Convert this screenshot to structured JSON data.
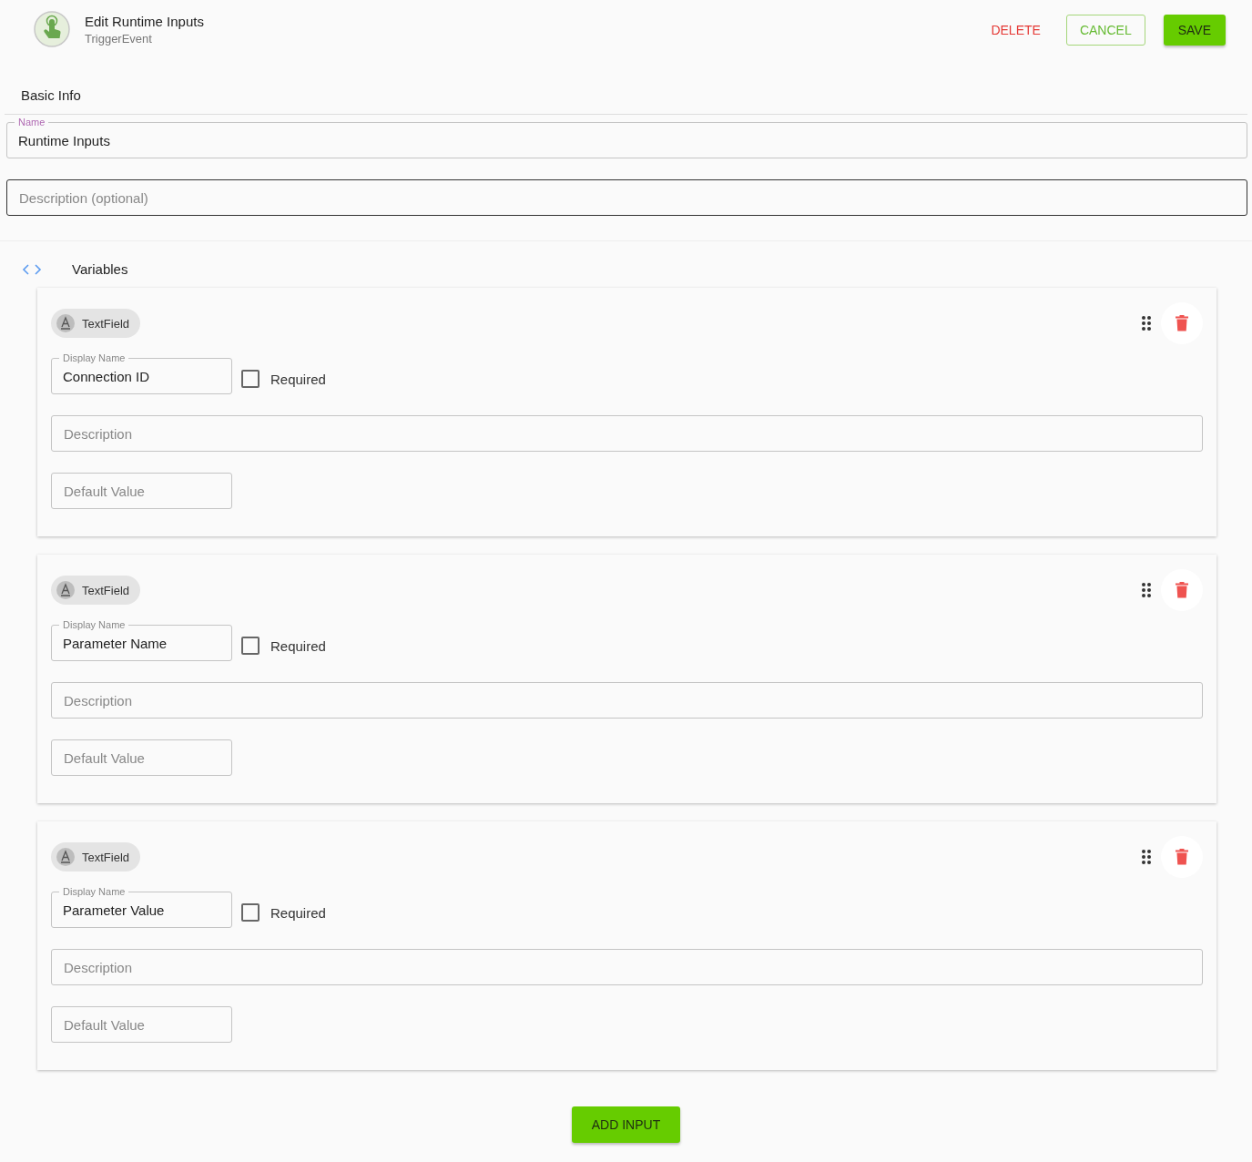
{
  "header": {
    "title": "Edit Runtime Inputs",
    "subtitle": "TriggerEvent",
    "actions": {
      "delete": "DELETE",
      "cancel": "CANCEL",
      "save": "SAVE"
    }
  },
  "basic_info": {
    "heading": "Basic Info",
    "name_field": {
      "label": "Name",
      "value": "Runtime Inputs"
    },
    "description_field": {
      "placeholder": "Description (optional)"
    }
  },
  "variables": {
    "heading": "Variables",
    "inputs": [
      {
        "type_chip": "TextField",
        "display_name": {
          "label": "Display Name",
          "value": "Connection ID"
        },
        "required": {
          "label": "Required",
          "checked": false
        },
        "description": {
          "placeholder": "Description"
        },
        "default_value": {
          "placeholder": "Default Value"
        }
      },
      {
        "type_chip": "TextField",
        "display_name": {
          "label": "Display Name",
          "value": "Parameter Name"
        },
        "required": {
          "label": "Required",
          "checked": false
        },
        "description": {
          "placeholder": "Description"
        },
        "default_value": {
          "placeholder": "Default Value"
        }
      },
      {
        "type_chip": "TextField",
        "display_name": {
          "label": "Display Name",
          "value": "Parameter Value"
        },
        "required": {
          "label": "Required",
          "checked": false
        },
        "description": {
          "placeholder": "Description"
        },
        "default_value": {
          "placeholder": "Default Value"
        }
      }
    ]
  },
  "add_button": "ADD INPUT"
}
